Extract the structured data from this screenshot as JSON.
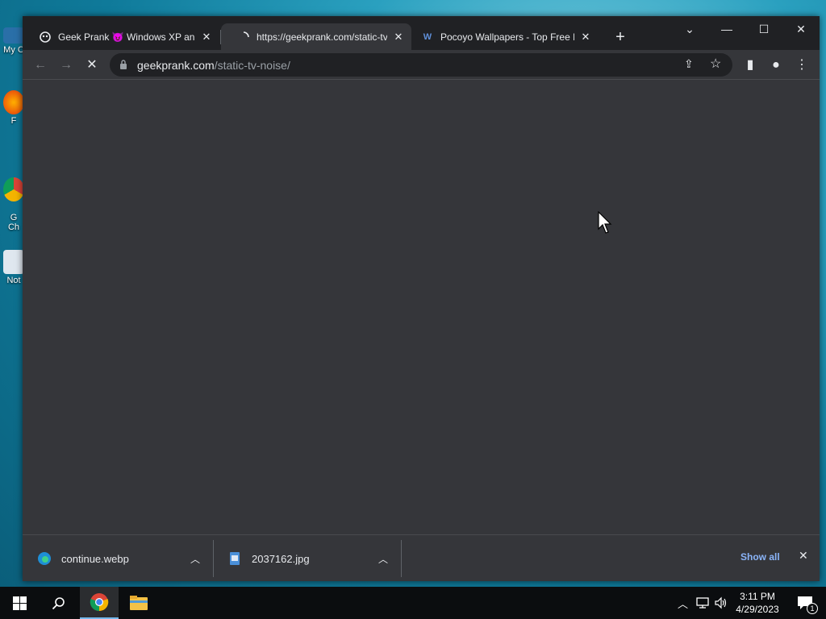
{
  "desktop": {
    "icons": [
      {
        "label": "My C",
        "icon": "computer-icon"
      },
      {
        "label": "F",
        "icon": "firefox-icon"
      },
      {
        "label": "G\nCh",
        "icon": "chrome-icon"
      },
      {
        "label": "Not",
        "icon": "notepad-icon"
      }
    ]
  },
  "browser": {
    "tabs": [
      {
        "title": "Geek Prank 😈 Windows XP and",
        "favicon": "geekprank-icon",
        "close": "✕",
        "active": false
      },
      {
        "title": "https://geekprank.com/static-tv-",
        "favicon": "loading-icon",
        "close": "✕",
        "active": true
      },
      {
        "title": "Pocoyo Wallpapers - Top Free Po",
        "favicon": "W",
        "close": "✕",
        "active": false
      }
    ],
    "new_tab": "+",
    "window_controls": {
      "tab_search": "⌄",
      "minimize": "—",
      "maximize": "☐",
      "close": "✕"
    },
    "toolbar": {
      "back": "←",
      "forward": "→",
      "stop": "✕",
      "share": "⇪",
      "bookmark": "☆",
      "side_panel": "▮",
      "profile": "●",
      "menu": "⋮"
    },
    "address": {
      "host": "geekprank.com",
      "path": "/static-tv-noise/"
    }
  },
  "downloads": {
    "items": [
      {
        "name": "continue.webp",
        "icon": "edge-icon"
      },
      {
        "name": "2037162.jpg",
        "icon": "image-file-icon"
      }
    ],
    "show_all": "Show all",
    "close": "✕"
  },
  "taskbar": {
    "time": "3:11 PM",
    "date": "4/29/2023",
    "notification_count": "1"
  },
  "colors": {
    "accent": "#8ab4f8",
    "window_bg": "#35363a",
    "titlebar": "#202124"
  }
}
